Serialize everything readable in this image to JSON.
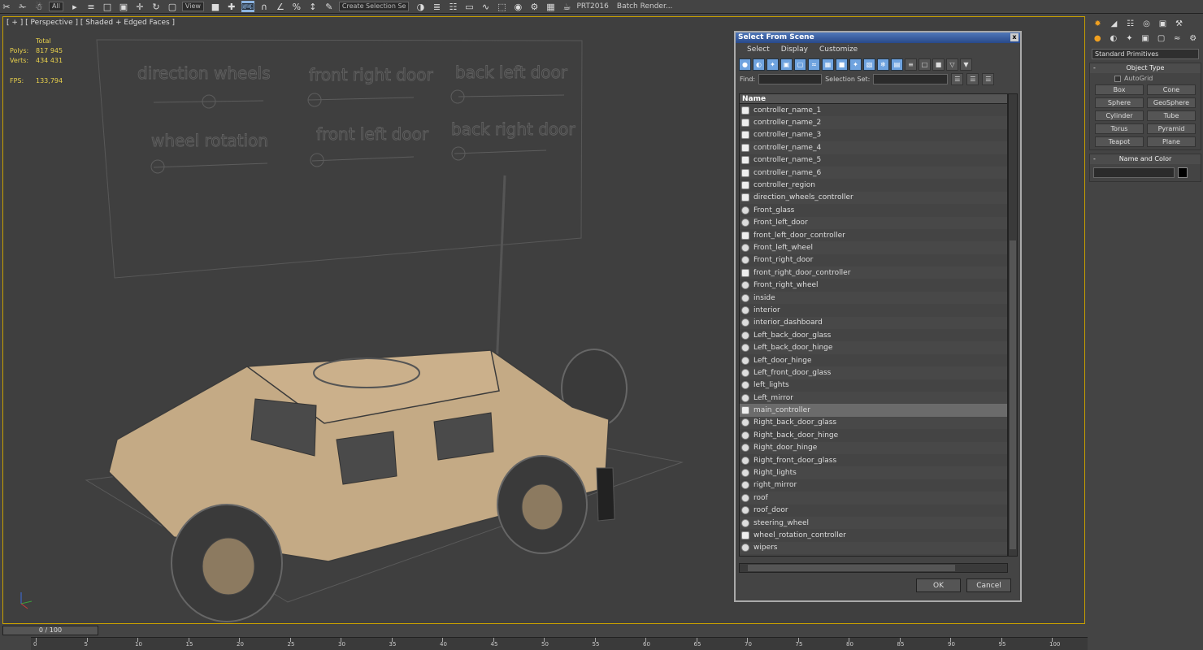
{
  "toolbar": {
    "select_filter": "All",
    "view": "View",
    "selection_set": "Create Selection Se",
    "prt": "PRT2016",
    "render": "Batch Render..."
  },
  "viewport": {
    "label": "[ + ] [ Perspective ] [ Shaded + Edged Faces ]",
    "stats_total": "Total",
    "polys_label": "Polys:",
    "polys_value": "817 945",
    "verts_label": "Verts:",
    "verts_value": "434 431",
    "fps_label": "FPS:",
    "fps_value": "133,794"
  },
  "scene_panel": {
    "labels": [
      "direction wheels",
      "front right door",
      "back left door",
      "wheel rotation",
      "front left door",
      "back right door"
    ]
  },
  "dialog": {
    "title": "Select From Scene",
    "close": "x",
    "menu": [
      "Select",
      "Display",
      "Customize"
    ],
    "find_label": "Find:",
    "selection_set_label": "Selection Set:",
    "column_name": "Name",
    "items": [
      {
        "name": "controller_name_1",
        "type": "ctrl"
      },
      {
        "name": "controller_name_2",
        "type": "ctrl"
      },
      {
        "name": "controller_name_3",
        "type": "ctrl"
      },
      {
        "name": "controller_name_4",
        "type": "ctrl"
      },
      {
        "name": "controller_name_5",
        "type": "ctrl"
      },
      {
        "name": "controller_name_6",
        "type": "ctrl"
      },
      {
        "name": "controller_region",
        "type": "ctrl"
      },
      {
        "name": "direction_wheels_controller",
        "type": "ctrl"
      },
      {
        "name": "Front_glass",
        "type": "geo"
      },
      {
        "name": "Front_left_door",
        "type": "geo"
      },
      {
        "name": "front_left_door_controller",
        "type": "ctrl"
      },
      {
        "name": "Front_left_wheel",
        "type": "geo"
      },
      {
        "name": "Front_right_door",
        "type": "geo"
      },
      {
        "name": "front_right_door_controller",
        "type": "ctrl"
      },
      {
        "name": "Front_right_wheel",
        "type": "geo"
      },
      {
        "name": "inside",
        "type": "geo"
      },
      {
        "name": "interior",
        "type": "geo"
      },
      {
        "name": "interior_dashboard",
        "type": "geo"
      },
      {
        "name": "Left_back_door_glass",
        "type": "geo"
      },
      {
        "name": "Left_back_door_hinge",
        "type": "geo"
      },
      {
        "name": "Left_door_hinge",
        "type": "geo"
      },
      {
        "name": "Left_front_door_glass",
        "type": "geo"
      },
      {
        "name": "left_lights",
        "type": "geo"
      },
      {
        "name": "Left_mirror",
        "type": "geo"
      },
      {
        "name": "main_controller",
        "type": "ctrl",
        "selected": true
      },
      {
        "name": "Right_back_door_glass",
        "type": "geo"
      },
      {
        "name": "Right_back_door_hinge",
        "type": "geo"
      },
      {
        "name": "Right_door_hinge",
        "type": "geo"
      },
      {
        "name": "Right_front_door_glass",
        "type": "geo"
      },
      {
        "name": "Right_lights",
        "type": "geo"
      },
      {
        "name": "right_mirror",
        "type": "geo"
      },
      {
        "name": "roof",
        "type": "geo"
      },
      {
        "name": "roof_door",
        "type": "geo"
      },
      {
        "name": "steering_wheel",
        "type": "geo"
      },
      {
        "name": "wheel_rotation_controller",
        "type": "ctrl"
      },
      {
        "name": "wipers",
        "type": "geo"
      }
    ],
    "ok": "OK",
    "cancel": "Cancel"
  },
  "command_panel": {
    "category": "Standard Primitives",
    "object_type_title": "Object Type",
    "autogrid": "AutoGrid",
    "buttons": [
      "Box",
      "Cone",
      "Sphere",
      "GeoSphere",
      "Cylinder",
      "Tube",
      "Torus",
      "Pyramid",
      "Teapot",
      "Plane"
    ],
    "name_color_title": "Name and Color",
    "color": "#000000"
  },
  "timeline": {
    "frame": "0 / 100",
    "ticks": [
      "0",
      "5",
      "10",
      "15",
      "20",
      "25",
      "30",
      "35",
      "40",
      "45",
      "50",
      "55",
      "60",
      "65",
      "70",
      "75",
      "80",
      "85",
      "90",
      "95",
      "100"
    ]
  },
  "colors": {
    "accent": "#6fa3df",
    "viewport_border": "#c8a000",
    "stat_text": "#e8d04c",
    "vehicle": "#c4aa85"
  }
}
